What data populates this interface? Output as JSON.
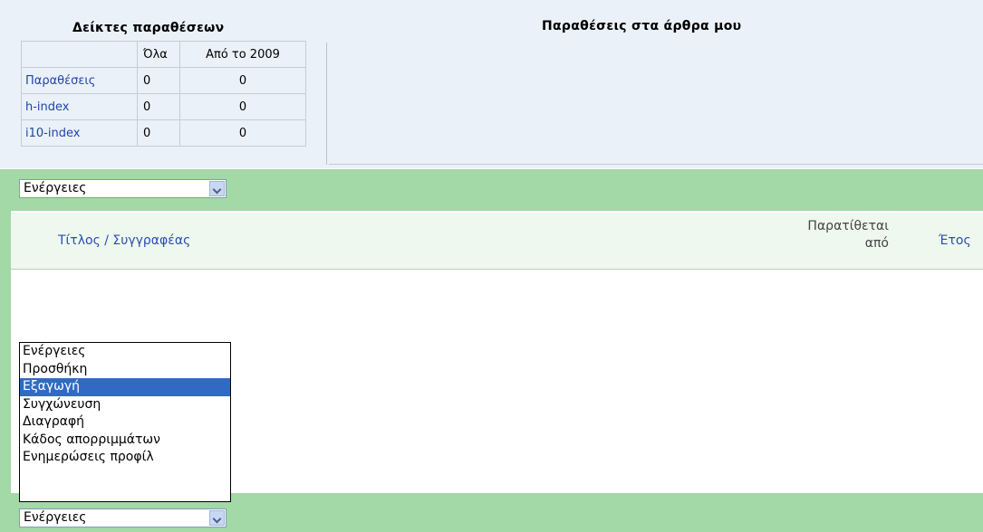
{
  "stats": {
    "title": "Δείκτες παραθέσεων",
    "columns": [
      "Όλα",
      "Από το 2009"
    ],
    "rows": [
      {
        "label": "Παραθέσεις",
        "all": "0",
        "since": "0"
      },
      {
        "label": "h-index",
        "all": "0",
        "since": "0"
      },
      {
        "label": "i10-index",
        "all": "0",
        "since": "0"
      }
    ]
  },
  "citations_title": "Παραθέσεις στα άρθρα μου",
  "actions_select": {
    "value": "Ενέργειες"
  },
  "table_header": {
    "title_author": "Τίτλος / Συγγραφέας",
    "cited_by_line1": "Παρατίθεται",
    "cited_by_line2": "από",
    "year": "Έτος"
  },
  "dropdown": {
    "options": [
      "Ενέργειες",
      "Προσθήκη",
      "Εξαγωγή",
      "Συγχώνευση",
      "Διαγραφή",
      "Κάδος απορριμμάτων",
      "Ενημερώσεις προφίλ"
    ],
    "selected_index": 2
  },
  "colors": {
    "link": "#2b4fb0",
    "green_bar": "#a3d8a7",
    "selection": "#316ac5",
    "top_bg": "#eaf1f8"
  }
}
